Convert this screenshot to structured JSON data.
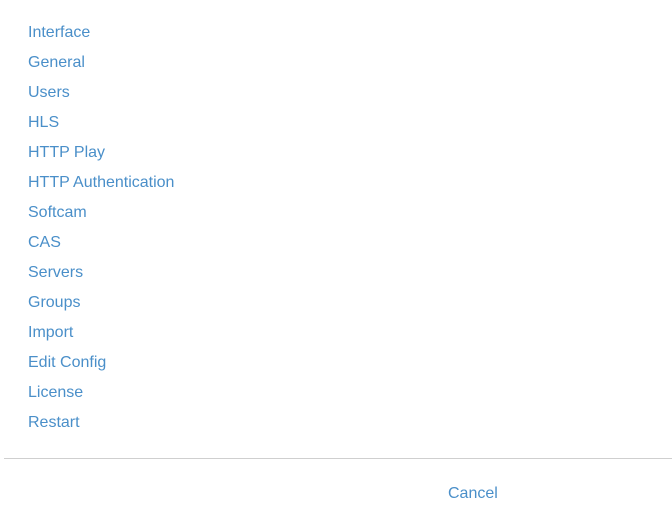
{
  "menu": {
    "items": [
      {
        "label": "Interface"
      },
      {
        "label": "General"
      },
      {
        "label": "Users"
      },
      {
        "label": "HLS"
      },
      {
        "label": "HTTP Play"
      },
      {
        "label": "HTTP Authentication"
      },
      {
        "label": "Softcam"
      },
      {
        "label": "CAS"
      },
      {
        "label": "Servers"
      },
      {
        "label": "Groups"
      },
      {
        "label": "Import"
      },
      {
        "label": "Edit Config"
      },
      {
        "label": "License"
      },
      {
        "label": "Restart"
      }
    ]
  },
  "footer": {
    "cancel_label": "Cancel"
  },
  "colors": {
    "link": "#4a8fc9",
    "divider": "#cfcfcf",
    "background": "#ffffff"
  }
}
